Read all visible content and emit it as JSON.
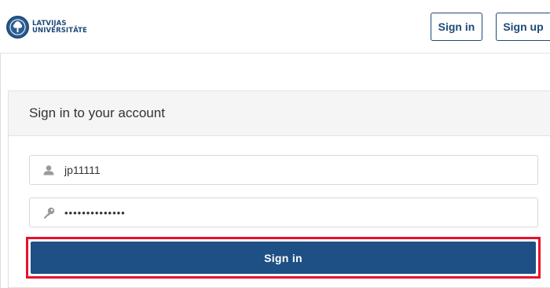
{
  "header": {
    "logo_line1": "LATVIJAS",
    "logo_line2": "UNIVERSITĀTE",
    "signin_label": "Sign in",
    "signup_label": "Sign up"
  },
  "form": {
    "title": "Sign in to your account",
    "username_value": "jp11111",
    "password_masked": "••••••••••••••",
    "submit_label": "Sign in"
  },
  "colors": {
    "brand": "#1f4a79",
    "button": "#1e4f85",
    "highlight": "#e8112d"
  },
  "icons": {
    "logo": "university-seal-icon",
    "username": "user-icon",
    "password": "key-icon"
  }
}
